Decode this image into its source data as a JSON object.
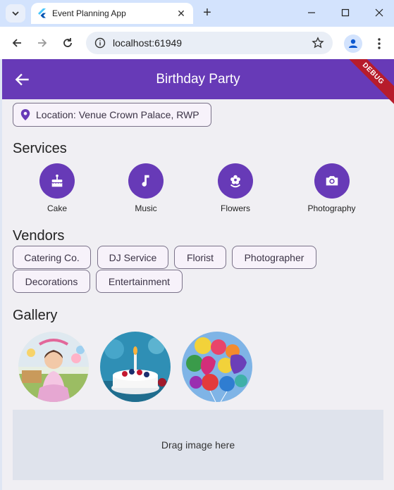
{
  "browser": {
    "tab_title": "Event Planning App",
    "url": "localhost:61949"
  },
  "appbar": {
    "title": "Birthday Party",
    "debug_banner": "DEBUG"
  },
  "location": {
    "text": "Location: Venue Crown Palace, RWP"
  },
  "services": {
    "heading": "Services",
    "items": [
      {
        "label": "Cake",
        "icon": "cake-icon"
      },
      {
        "label": "Music",
        "icon": "music-note-icon"
      },
      {
        "label": "Flowers",
        "icon": "flower-icon"
      },
      {
        "label": "Photography",
        "icon": "camera-icon"
      }
    ]
  },
  "vendors": {
    "heading": "Vendors",
    "items": [
      "Catering Co.",
      "DJ Service",
      "Florist",
      "Photographer",
      "Decorations",
      "Entertainment"
    ]
  },
  "gallery": {
    "heading": "Gallery",
    "images": [
      "child-birthday-photo",
      "birthday-cake-photo",
      "balloons-photo"
    ],
    "dropzone_text": "Drag image here"
  },
  "colors": {
    "primary": "#673ab7",
    "background": "#f0eff3",
    "debug": "#b71c2b"
  }
}
